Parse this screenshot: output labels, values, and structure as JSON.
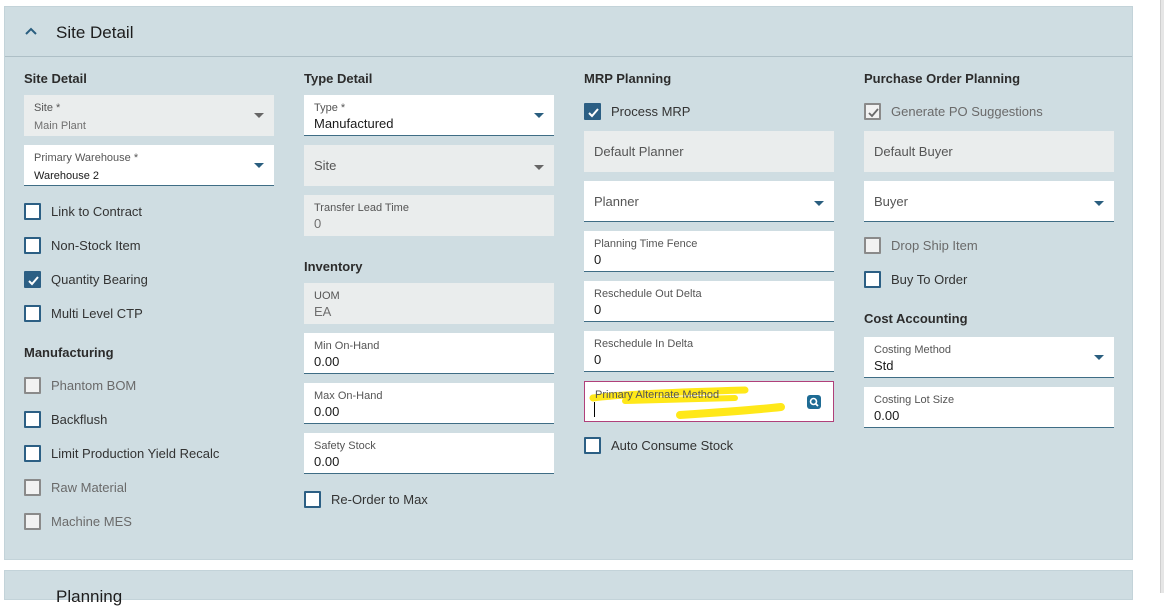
{
  "panel": {
    "title": "Site Detail"
  },
  "site_detail": {
    "title": "Site Detail",
    "site": {
      "label": "Site *",
      "value": "Main Plant"
    },
    "primary_warehouse": {
      "label": "Primary Warehouse *",
      "value": "Warehouse 2"
    },
    "checks": [
      {
        "label": "Link to Contract",
        "checked": false
      },
      {
        "label": "Non-Stock Item",
        "checked": false
      },
      {
        "label": "Quantity Bearing",
        "checked": true
      },
      {
        "label": "Multi Level CTP",
        "checked": false
      }
    ]
  },
  "manufacturing": {
    "title": "Manufacturing",
    "checks": [
      {
        "label": "Phantom BOM",
        "checked": false,
        "enabled": false
      },
      {
        "label": "Backflush",
        "checked": false,
        "enabled": true
      },
      {
        "label": "Limit Production Yield Recalc",
        "checked": false,
        "enabled": true
      },
      {
        "label": "Raw Material",
        "checked": false,
        "enabled": false
      },
      {
        "label": "Machine MES",
        "checked": false,
        "enabled": false
      }
    ]
  },
  "type_detail": {
    "title": "Type Detail",
    "type": {
      "label": "Type *",
      "value": "Manufactured"
    },
    "site": {
      "placeholder": "Site"
    },
    "transfer_lead_time": {
      "label": "Transfer Lead Time",
      "value": "0"
    }
  },
  "inventory": {
    "title": "Inventory",
    "uom": {
      "label": "UOM",
      "value": "EA"
    },
    "min_on_hand": {
      "label": "Min On-Hand",
      "value": "0.00"
    },
    "max_on_hand": {
      "label": "Max On-Hand",
      "value": "0.00"
    },
    "safety_stock": {
      "label": "Safety Stock",
      "value": "0.00"
    },
    "reorder_to_max": {
      "label": "Re-Order to Max",
      "checked": false
    }
  },
  "mrp_planning": {
    "title": "MRP Planning",
    "process_mrp": {
      "label": "Process MRP",
      "checked": true
    },
    "default_planner": {
      "placeholder": "Default Planner"
    },
    "planner": {
      "placeholder": "Planner"
    },
    "planning_time_fence": {
      "label": "Planning Time Fence",
      "value": "0"
    },
    "reschedule_out_delta": {
      "label": "Reschedule Out Delta",
      "value": "0"
    },
    "reschedule_in_delta": {
      "label": "Reschedule In Delta",
      "value": "0"
    },
    "primary_alternate_method": {
      "label": "Primary Alternate Method",
      "value": ""
    },
    "auto_consume_stock": {
      "label": "Auto Consume Stock",
      "checked": false
    }
  },
  "po_planning": {
    "title": "Purchase Order Planning",
    "generate_po_suggestions": {
      "label": "Generate PO Suggestions",
      "checked": true
    },
    "default_buyer": {
      "placeholder": "Default Buyer"
    },
    "buyer": {
      "placeholder": "Buyer"
    },
    "drop_ship_item": {
      "label": "Drop Ship Item",
      "checked": false
    },
    "buy_to_order": {
      "label": "Buy To Order",
      "checked": false
    }
  },
  "cost_accounting": {
    "title": "Cost Accounting",
    "costing_method": {
      "label": "Costing Method",
      "value": "Std"
    },
    "costing_lot_size": {
      "label": "Costing Lot Size",
      "value": "0.00"
    }
  },
  "next_panel": {
    "title": "Planning"
  },
  "colors": {
    "panel_bg": "#cfdde2",
    "accent": "#2c5f84",
    "highlight": "#ffe600",
    "focus_border": "#b0407a"
  }
}
